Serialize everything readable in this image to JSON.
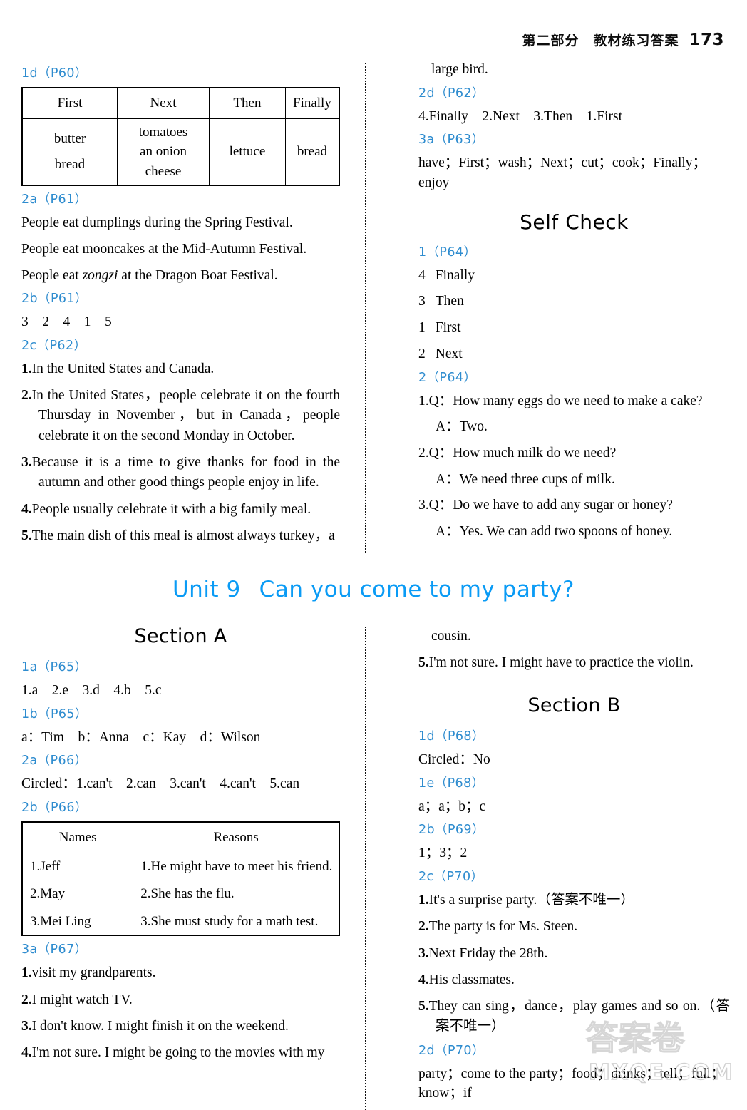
{
  "header": {
    "title": "第二部分　教材练习答案",
    "page_number": "173"
  },
  "left_top": {
    "label_1d": "1d（P60）",
    "table_1d": {
      "headers": [
        "First",
        "Next",
        "Then",
        "Finally"
      ],
      "row": [
        [
          "butter",
          "bread"
        ],
        [
          "tomatoes",
          "an onion",
          "cheese"
        ],
        [
          "lettuce"
        ],
        [
          "bread"
        ]
      ]
    },
    "label_2a": "2a（P61）",
    "answers_2a": [
      "People eat dumplings during the Spring Festival.",
      "People eat mooncakes at the Mid-Autumn Festival.",
      "People eat zongzi at the Dragon Boat Festival."
    ],
    "a2a_3_pre": "People eat ",
    "a2a_3_ital": "zongzi",
    "a2a_3_post": " at the Dragon Boat Festival.",
    "label_2b": "2b（P61）",
    "answer_2b": "3　2　4　1　5",
    "label_2c": "2c（P62）",
    "answers_2c": [
      {
        "num": "1.",
        "text": "In the United States and Canada."
      },
      {
        "num": "2.",
        "text": "In the United States，people celebrate it on the fourth Thursday in November，but in Canada，people celebrate it on the second Monday in October."
      },
      {
        "num": "3.",
        "text": "Because it is a time to give thanks for food in the autumn and other good things people enjoy in life."
      },
      {
        "num": "4.",
        "text": "People usually celebrate it with a big family meal."
      },
      {
        "num": "5.",
        "text": "The main dish of this meal is almost always turkey，a"
      }
    ]
  },
  "right_top": {
    "continuation": "large bird.",
    "label_2d": "2d（P62）",
    "answer_2d": "4.Finally　2.Next　3.Then　1.First",
    "label_3a": "3a（P63）",
    "answer_3a": "have；First；wash；Next；cut；cook；Finally；enjoy",
    "selfcheck_title": "Self Check",
    "label_1": "1（P64）",
    "list_1": [
      {
        "num": "4",
        "word": "Finally"
      },
      {
        "num": "3",
        "word": "Then"
      },
      {
        "num": "1",
        "word": "First"
      },
      {
        "num": "2",
        "word": "Next"
      }
    ],
    "label_2": "2（P64）",
    "qa_2": [
      {
        "q": "1.Q：How many eggs do we need to make a cake?",
        "a": "A：Two."
      },
      {
        "q": "2.Q：How much milk do we need?",
        "a": "A：We need three cups of milk."
      },
      {
        "q": "3.Q：Do we have to add any sugar or honey?",
        "a": "A：Yes. We can add two spoons of honey."
      }
    ]
  },
  "unit": {
    "number": "Unit 9",
    "title": "Can you come to my party?"
  },
  "left_bottom": {
    "section_title": "Section A",
    "label_1a": "1a（P65）",
    "answer_1a": "1.a　2.e　3.d　4.b　5.c",
    "label_1b": "1b（P65）",
    "answer_1b": "a：Tim　b：Anna　c：Kay　d：Wilson",
    "label_2a": "2a（P66）",
    "answer_2a": "Circled：1.can't　2.can　3.can't　4.can't　5.can",
    "label_2b": "2b（P66）",
    "table_2b": {
      "headers": [
        "Names",
        "Reasons"
      ],
      "rows": [
        [
          "1.Jeff",
          "1.He might have to meet his friend."
        ],
        [
          "2.May",
          "2.She has the flu."
        ],
        [
          "3.Mei Ling",
          "3.She must study for a math test."
        ]
      ]
    },
    "label_3a": "3a（P67）",
    "answers_3a": [
      {
        "num": "1.",
        "text": "visit my grandparents."
      },
      {
        "num": "2.",
        "text": "I might watch TV."
      },
      {
        "num": "3.",
        "text": "I don't know. I might finish it on the weekend."
      },
      {
        "num": "4.",
        "text": "I'm not sure. I might be going to the movies with my"
      }
    ]
  },
  "right_bottom": {
    "continuation": "cousin.",
    "answer_3a_5": {
      "num": "5.",
      "text": "I'm not sure. I might have to practice the violin."
    },
    "section_title": "Section B",
    "label_1d": "1d（P68）",
    "answer_1d": "Circled：No",
    "label_1e": "1e（P68）",
    "answer_1e": "a；a；b；c",
    "label_2b": "2b（P69）",
    "answer_2b": "1；3；2",
    "label_2c": "2c（P70）",
    "answers_2c": [
      {
        "num": "1.",
        "text": "It's a surprise party.（答案不唯一）"
      },
      {
        "num": "2.",
        "text": "The party is for Ms. Steen."
      },
      {
        "num": "3.",
        "text": "Next Friday the 28th."
      },
      {
        "num": "4.",
        "text": "His classmates."
      },
      {
        "num": "5.",
        "text": "They can sing，dance，play games and so on.（答案不唯一）"
      }
    ],
    "label_2d": "2d（P70）",
    "answer_2d": "party；come to the party；food；drinks；tell；full；know；if"
  },
  "watermark": {
    "cjk": "答案卷",
    "domain": "MXQE.COM"
  },
  "colors": {
    "label_blue": "#2e8ccf",
    "unit_blue": "#0a9bf5",
    "text_black": "#000000"
  }
}
